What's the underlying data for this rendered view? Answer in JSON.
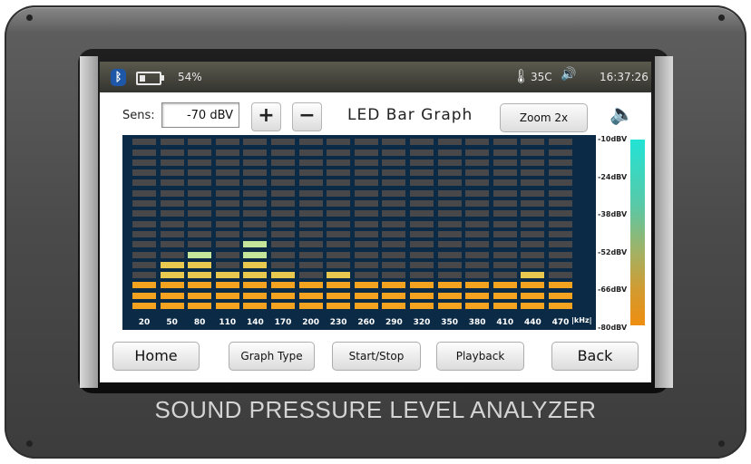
{
  "status_bar": {
    "bluetooth_icon": "bluetooth-icon",
    "battery_percent": "54%",
    "battery_level": 0.3,
    "temperature": "35C",
    "time": "16:37:26"
  },
  "controls": {
    "sens_label": "Sens:",
    "sens_value": "-70 dBV",
    "plus_label": "+",
    "minus_label": "−",
    "title": "LED Bar Graph",
    "zoom_label": "Zoom 2x",
    "speaker_icon": "speaker-icon"
  },
  "chart_data": {
    "type": "bar",
    "categories": [
      "20",
      "50",
      "80",
      "110",
      "140",
      "170",
      "200",
      "230",
      "260",
      "290",
      "320",
      "350",
      "380",
      "410",
      "440",
      "470"
    ],
    "xlabel": "kHz",
    "values": [
      3,
      5,
      6,
      4,
      7,
      4,
      3,
      4,
      3,
      3,
      3,
      3,
      3,
      3,
      4,
      3
    ],
    "segments_total": 17,
    "ylabels": [
      "-10dBV",
      "-24dBV",
      "-38dBV",
      "-52dBV",
      "-66dBV",
      "-80dBV"
    ],
    "colors": {
      "off": "#48484a",
      "orange": "#f3a320",
      "yellow": "#e9c850",
      "green": "#b8d782",
      "lightgreen": "#c5e59a"
    }
  },
  "buttons": {
    "home": "Home",
    "graph_type": "Graph Type",
    "start_stop": "Start/Stop",
    "playback": "Playback",
    "back": "Back"
  },
  "device_label": "SOUND PRESSURE LEVEL ANALYZER"
}
